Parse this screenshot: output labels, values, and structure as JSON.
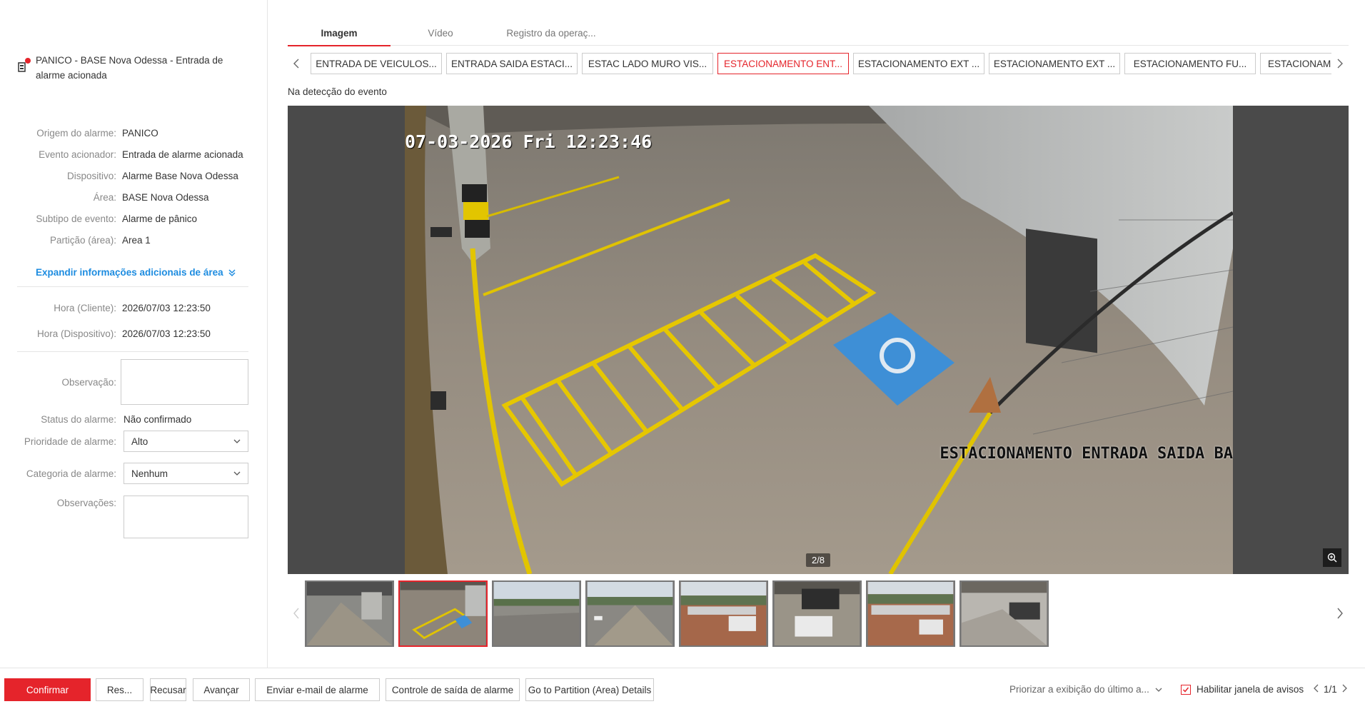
{
  "alarm": {
    "title": "PANICO - BASE Nova Odessa - Entrada de alarme acionada",
    "icon": "alarm-device-icon",
    "status_dot_color": "#e5242b"
  },
  "info": [
    {
      "label": "Origem do alarme:",
      "value": "PANICO"
    },
    {
      "label": "Evento acionador:",
      "value": "Entrada de alarme acionada"
    },
    {
      "label": "Dispositivo:",
      "value": "Alarme Base Nova Odessa"
    },
    {
      "label": "Área:",
      "value": "BASE Nova Odessa"
    },
    {
      "label": "Subtipo de evento:",
      "value": "Alarme de pânico"
    },
    {
      "label": "Partição (área):",
      "value": "Area 1"
    }
  ],
  "expand_label": "Expandir informações adicionais de área",
  "times": [
    {
      "label": "Hora (Cliente):",
      "value": "2026/07/03 12:23:50"
    },
    {
      "label": "Hora (Dispositivo):",
      "value": "2026/07/03 12:23:50"
    }
  ],
  "form": {
    "observacao_label": "Observação:",
    "status_label": "Status do alarme:",
    "status_value": "Não confirmado",
    "prioridade_label": "Prioridade de alarme:",
    "prioridade_value": "Alto",
    "categoria_label": "Categoria de alarme:",
    "categoria_value": "Nenhum",
    "observacoes_label": "Observações:"
  },
  "tabs": [
    {
      "label": "Imagem",
      "active": true
    },
    {
      "label": "Vídeo",
      "active": false
    },
    {
      "label": "Registro da operaç...",
      "active": false
    }
  ],
  "cameras": [
    {
      "label": "ENTRADA DE VEICULOS...",
      "active": false
    },
    {
      "label": "ENTRADA SAIDA ESTACI...",
      "active": false
    },
    {
      "label": "ESTAC LADO MURO VIS...",
      "active": false
    },
    {
      "label": "ESTACIONAMENTO ENT...",
      "active": true
    },
    {
      "label": "ESTACIONAMENTO EXT ...",
      "active": false
    },
    {
      "label": "ESTACIONAMENTO EXT ...",
      "active": false
    },
    {
      "label": "ESTACIONAMENTO FU...",
      "active": false
    },
    {
      "label": "ESTACIONAM",
      "active": false
    }
  ],
  "event_caption": "Na detecção do evento",
  "viewer": {
    "osd_time": "07-03-2026 Fri 12:23:46",
    "osd_name": "ESTACIONAMENTO ENTRADA SAIDA BA",
    "page_indicator": "2/8"
  },
  "thumbnails": {
    "count": 8,
    "active_index": 1
  },
  "bottom": {
    "confirmar": "Confirmar",
    "res": "Res...",
    "recusar": "Recusar",
    "avancar": "Avançar",
    "email": "Enviar e-mail de alarme",
    "controle": "Controle de saída de alarme",
    "partition": "Go to Partition (Area) Details",
    "priorizar": "Priorizar a exibição do último a...",
    "habilitar": "Habilitar janela de avisos",
    "pager": "1/1"
  },
  "colors": {
    "accent": "#e5242b",
    "link": "#1d8ce0"
  }
}
